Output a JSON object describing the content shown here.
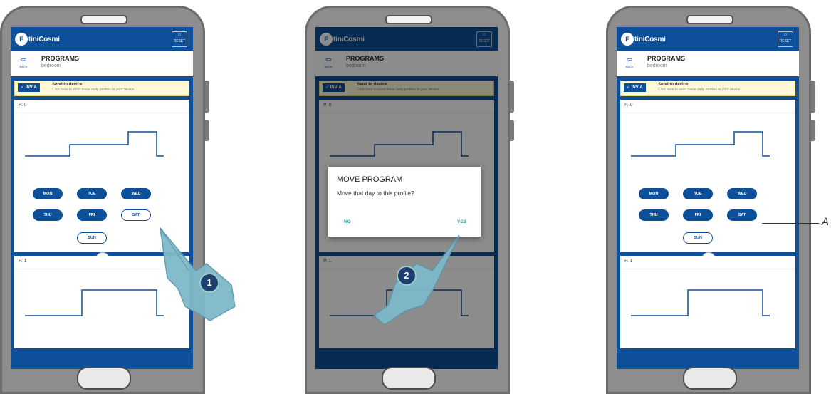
{
  "app": {
    "logo_letter": "F",
    "logo_text": "tiniCosmi",
    "reset_label": "RESET",
    "back_label": "BACK",
    "page_title": "PROGRAMS",
    "page_subtitle": "bedroom"
  },
  "banner": {
    "button_label": "INVIA",
    "title": "Send to device",
    "subtitle": "Click here to send these daily profiles to your device"
  },
  "profiles": [
    {
      "name": "P. 0"
    },
    {
      "name": "P. 1"
    }
  ],
  "days": {
    "mon": "MON",
    "tue": "TUE",
    "wed": "WED",
    "thu": "THU",
    "fri": "FRI",
    "sat": "SAT",
    "sun": "SUN"
  },
  "dialog": {
    "title": "MOVE PROGRAM",
    "message": "Move that day to this profile?",
    "no_label": "NO",
    "yes_label": "YES"
  },
  "steps": {
    "step1": "1",
    "step2": "2"
  },
  "callout": {
    "label": "A"
  },
  "colors": {
    "brand_blue": "#0d4f98",
    "dialog_accent": "#18a08c",
    "banner_bg": "#fff9d8"
  }
}
